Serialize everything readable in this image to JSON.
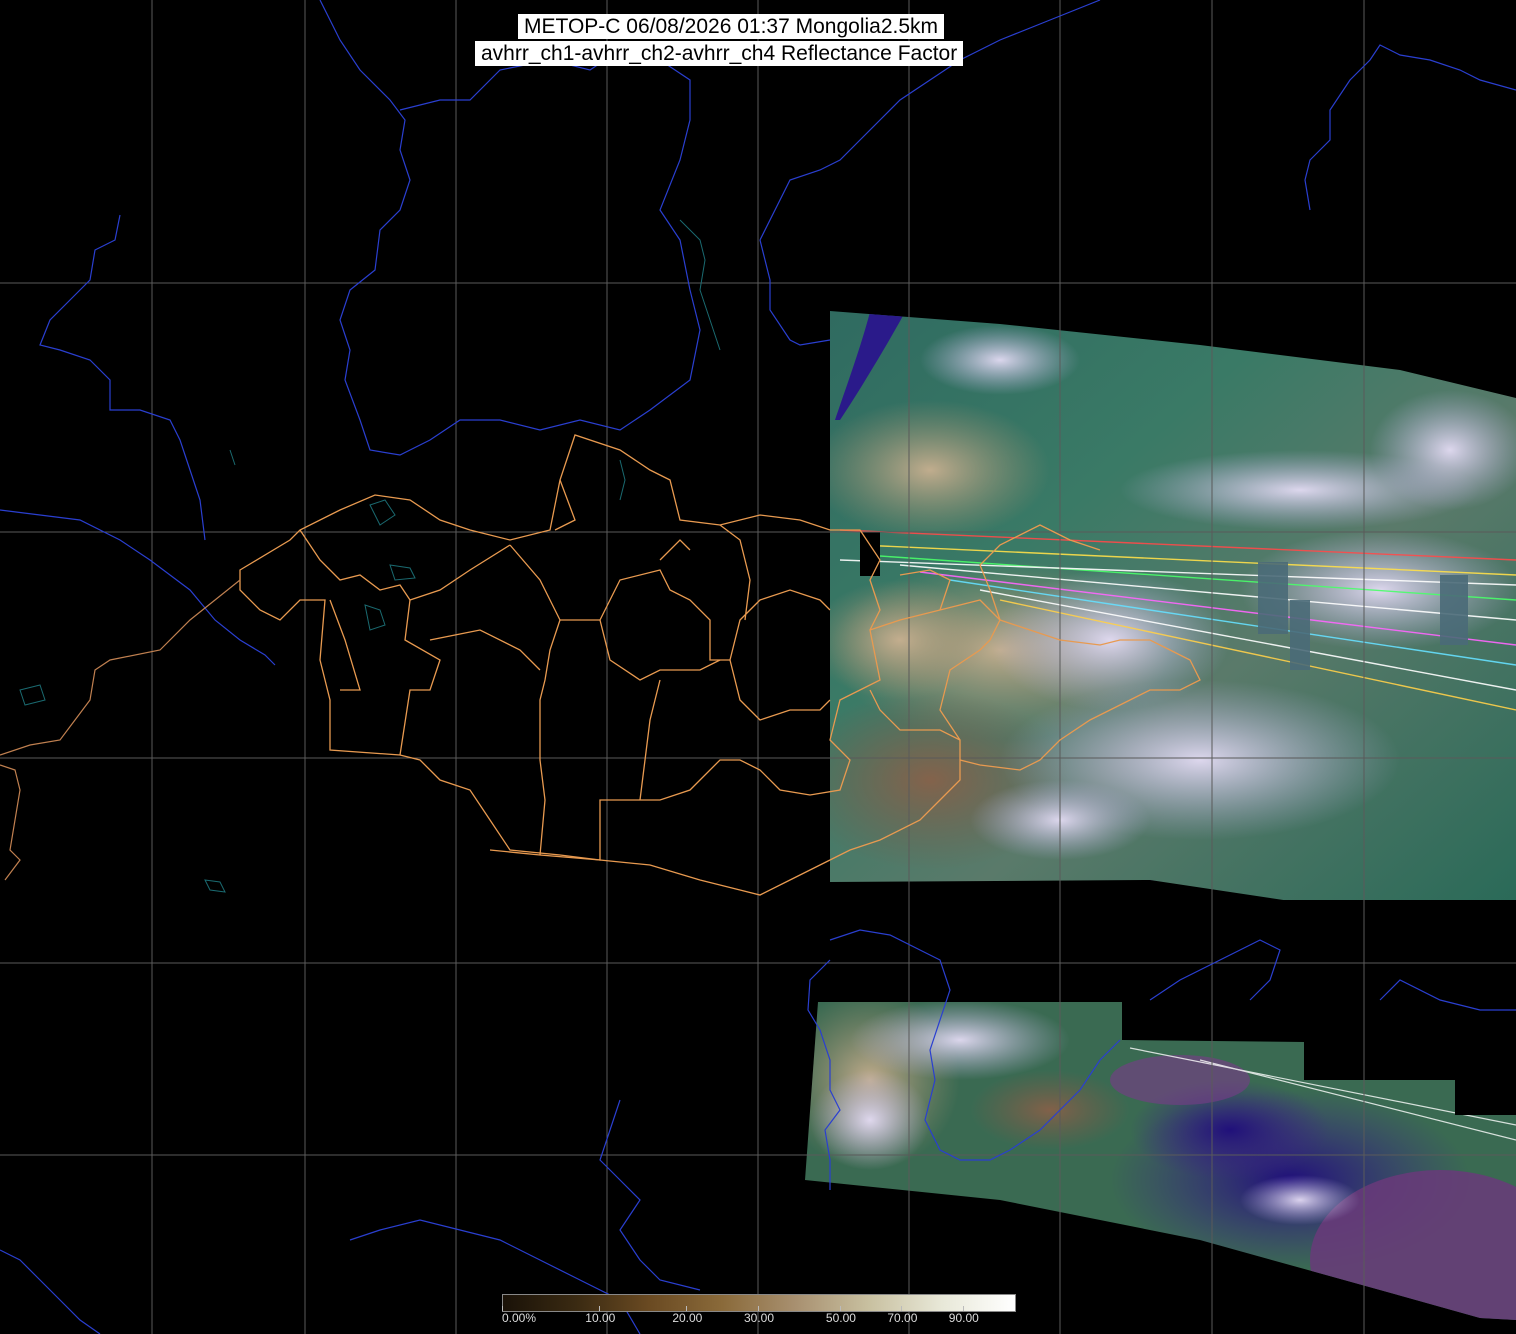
{
  "title": {
    "line1": "METOP-C 06/08/2026 01:37 Mongolia2.5km",
    "line2": "avhrr_ch1-avhrr_ch2-avhrr_ch4 Reflectance Factor"
  },
  "colorbar": {
    "ticks": [
      "0.00%",
      "10.00",
      "20.00",
      "30.00",
      "50.00",
      "70.00",
      "90.00"
    ],
    "tick_values": [
      0,
      10,
      20,
      30,
      50,
      70,
      90
    ],
    "color_stops": [
      "#1a1208",
      "#3a2a12",
      "#6a4a22",
      "#8a6a3a",
      "#a89070",
      "#c8c0a0",
      "#e8e8d8",
      "#ffffff"
    ]
  },
  "colors": {
    "background": "#000000",
    "grid": "#5a5a5a",
    "coastline": "#2a3fd0",
    "lakes": "#1a6a70",
    "admin_border": "#e89a50",
    "cloud": "#c8c0e8",
    "vegetation": "#2d6a5a",
    "desert": "#b8a080",
    "water": "#2a1a80"
  }
}
